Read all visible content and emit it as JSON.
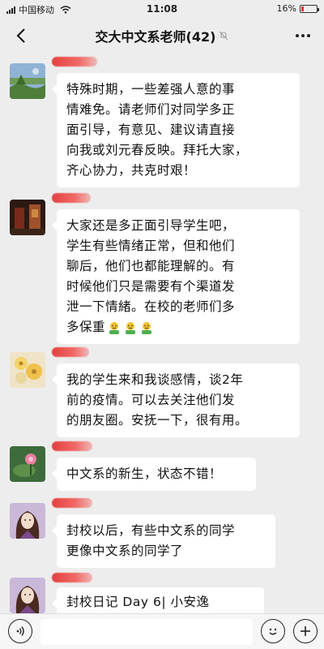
{
  "status_bar": {
    "carrier": "中国移动",
    "time": "11:08",
    "battery": "16%",
    "battery_level": 0.16,
    "battery_color": "#dd3333"
  },
  "nav": {
    "title": "交大中文系老师(42)",
    "back_icon": "chevron-left-icon",
    "mute_icon": "mute-bell-icon",
    "more_icon": "more-dots-icon"
  },
  "messages": [
    {
      "text": "特殊时期，一些差强人意的事情难免。请老师们对同学多正面引导，有意见、建议请直接向我或刘元春反映。拜托大家，齐心协力，共克时艰！",
      "lines": [
        "特殊时期，一些差强人意的事",
        "情难免。请老师们对同学多正",
        "面引导，有意见、建议请直接",
        "向我或刘元春反映。拜托大家，",
        "齐心协力，共克时艰！"
      ]
    },
    {
      "text": "大家还是多正面引导学生吧，学生有些情绪正常，但和他们聊后，他们也都能理解的。有时候他们只是需要有个渠道发泄一下情绪。在校的老师们多多保重",
      "lines": [
        "大家还是多正面引导学生吧，",
        "学生有些情绪正常，但和他们",
        "聊后，他们也都能理解的。有",
        "时候他们只是需要有个渠道发",
        "泄一下情緒。在校的老师们多",
        "多保重"
      ],
      "emoji_count": 3,
      "emoji_icon": "flower-emoji-icon"
    },
    {
      "text": "我的学生来和我谈感情，谈2年前的疫情。可以去关注他们发的朋友圈。安抚一下，很有用。",
      "lines": [
        "我的学生来和我谈感情，谈2年",
        "前的疫情。可以去关注他们发",
        "的朋友圈。安抚一下，很有用。"
      ]
    },
    {
      "text": "中文系的新生，状态不错！",
      "lines": [
        "中文系的新生，状态不错！"
      ]
    },
    {
      "text": "封校以后，有些中文系的同学更像中文系的同学了",
      "lines": [
        "封校以后，有些中文系的同学",
        "更像中文系的同学了"
      ]
    },
    {
      "text": "封校日记 Day 6| 小安逸",
      "lines": [
        "封校日记 Day 6| 小安逸"
      ]
    }
  ],
  "input_bar": {
    "voice_icon": "voice-icon",
    "emoji_icon": "emoji-icon",
    "plus_icon": "plus-icon"
  }
}
